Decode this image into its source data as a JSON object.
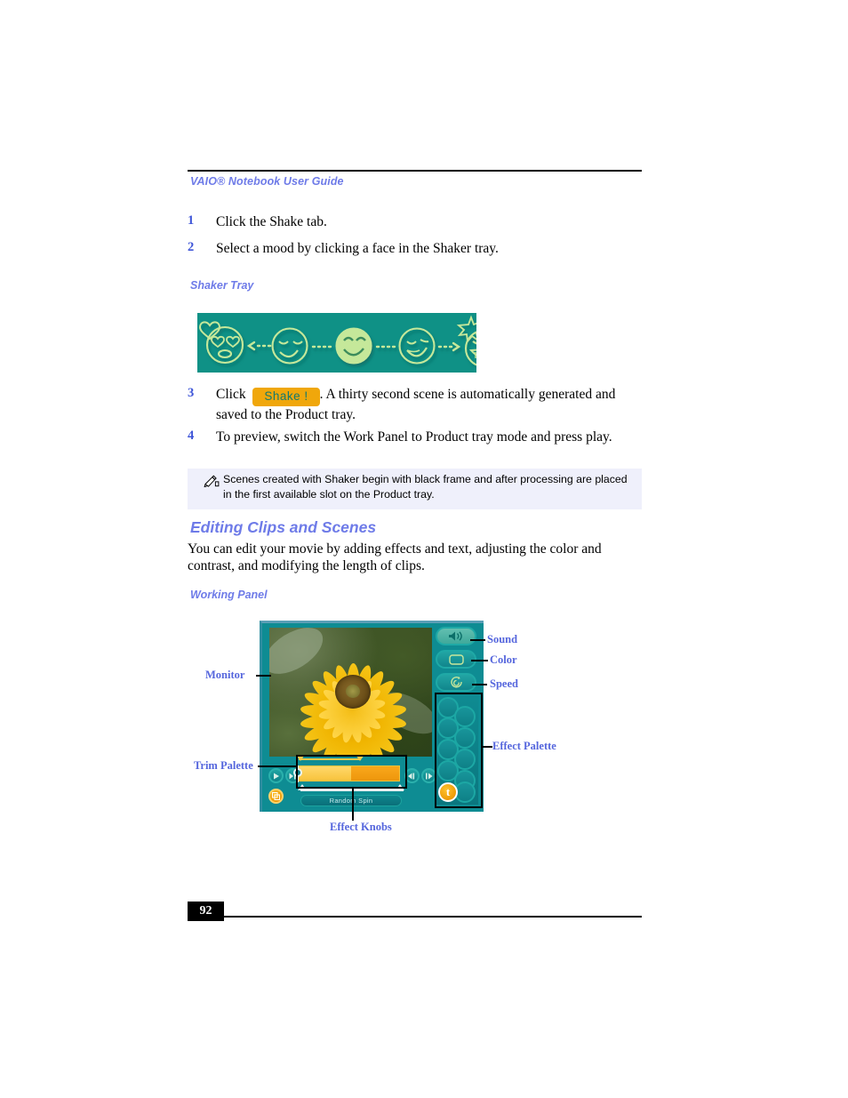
{
  "header": {
    "title": "VAIO® Notebook User Guide"
  },
  "steps": [
    {
      "num": "1",
      "text": "Click the Shake tab."
    },
    {
      "num": "2",
      "text": "Select a mood by clicking a face in the Shaker tray."
    }
  ],
  "shaker_tray": {
    "caption": "Shaker Tray",
    "faces": [
      {
        "name": "face-in-love",
        "selected": false
      },
      {
        "name": "face-content",
        "selected": false
      },
      {
        "name": "face-happy",
        "selected": true
      },
      {
        "name": "face-playful",
        "selected": false
      },
      {
        "name": "face-excited",
        "selected": false
      }
    ],
    "bg_color": "#0F9186",
    "stroke_color": "#C5E89A"
  },
  "step3": {
    "num": "3",
    "before": "Click",
    "button_label": "Shake !",
    "after": ". A thirty second scene is automatically generated and saved to the Product tray."
  },
  "step4": {
    "num": "4",
    "text": "To preview, switch the Work Panel to Product tray mode and press play."
  },
  "note": {
    "icon": "pencil-note-icon",
    "text": "Scenes created with Shaker begin with black frame and after processing are placed in the first available slot on the Product tray."
  },
  "section": {
    "title": "Editing Clips and Scenes",
    "paragraph": "You can edit your movie by adding effects and text, adjusting the color and contrast, and modifying the length of clips."
  },
  "working_panel": {
    "caption": "Working Panel",
    "buttons": [
      {
        "name": "sound-button",
        "icon": "speaker-icon",
        "label": "Sound",
        "active": true
      },
      {
        "name": "color-button",
        "icon": "screen-icon",
        "label": "Color",
        "active": false
      },
      {
        "name": "speed-button",
        "icon": "spiral-icon",
        "label": "Speed",
        "active": false
      }
    ],
    "effect_palette_label": "Effect Palette",
    "effect_palette_text_button": "t",
    "monitor_label": "Monitor",
    "trim_palette_label": "Trim Palette",
    "effect_knobs_label": "Effect Knobs",
    "effect_name": "Random Spin",
    "panel_bg": "#0E8C93",
    "accent_orange": "#EE9A06",
    "label_color": "#5566DD"
  },
  "footer": {
    "page_number": "92"
  }
}
